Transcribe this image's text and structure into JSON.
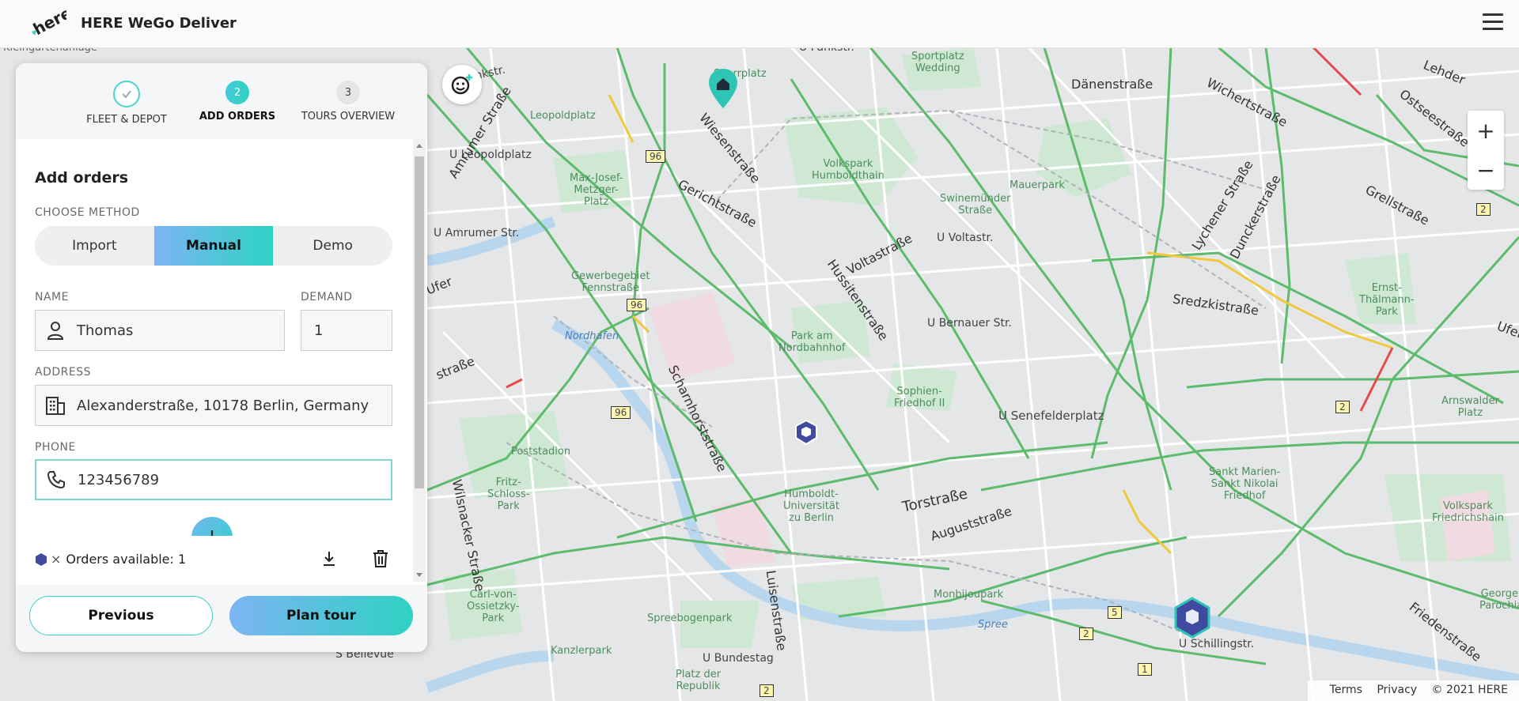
{
  "app": {
    "title": "HERE WeGo Deliver",
    "logo_text": "here"
  },
  "stepper": [
    {
      "number": "1",
      "label": "FLEET & DEPOT",
      "state": "done"
    },
    {
      "number": "2",
      "label": "ADD ORDERS",
      "state": "active"
    },
    {
      "number": "3",
      "label": "TOURS OVERVIEW",
      "state": "todo"
    }
  ],
  "form": {
    "heading": "Add orders",
    "method_caption": "CHOOSE METHOD",
    "methods": [
      "Import",
      "Manual",
      "Demo"
    ],
    "selected_method": "Manual",
    "name_caption": "NAME",
    "name_value": "Thomas",
    "demand_caption": "DEMAND",
    "demand_value": "1",
    "address_caption": "ADDRESS",
    "address_value": "Alexanderstraße, 10178 Berlin, Germany",
    "phone_caption": "PHONE",
    "phone_value": "123456789"
  },
  "orders": {
    "multiplier": "×",
    "label": "Orders available: 1"
  },
  "footer": {
    "previous_label": "Previous",
    "plan_label": "Plan tour"
  },
  "map": {
    "zoom_in": "+",
    "zoom_out": "−",
    "attribution": {
      "terms": "Terms",
      "privacy": "Privacy",
      "copyright": "© 2021 HERE"
    },
    "colors": {
      "accent": "#2ed2c3",
      "order_marker": "#3f4aa0",
      "depot_marker": "#2ec5b6",
      "rail": "#4caf50"
    },
    "labels": {
      "l1": "Kleingartenanlage",
      "l2": "Leopoldplatz",
      "l3": "U Leopoldplatz",
      "l4": "U Amrumer Str.",
      "l5": "Max-Josef-\nMetzger-\nPlatz",
      "l6": "Gewerbegebiet\nFennstraße",
      "l7": "Nordhafen",
      "l8": "Gerichtstraße",
      "l9": "Wiesenstraße",
      "l10": "Volkspark\nHumboldthain",
      "l11": "Hussitenstraße",
      "l12": "Voltastraße",
      "l13": "U Voltastr.",
      "l14": "Swinemünder\nStraße",
      "l15": "Mauerpark",
      "l16": "Dänenstraße",
      "l17": "Wichertstraße",
      "l18": "Lychener Straße",
      "l19": "Dunckerstraße",
      "l20": "Grellstraße",
      "l21": "Ostseestraße",
      "l22": "Sportplatz\nWedding",
      "l23": "Scharnhorststraße",
      "l24": "Park am\nNordbahnhof",
      "l25": "U Bernauer Str.",
      "l26": "Sophien-\nFriedhof II",
      "l27": "U Senefelderplatz",
      "l28": "Sredzkistraße",
      "l29": "Ernst-\nThälmann-\nPark",
      "l30": "Arnswalder\nPlatz",
      "l31": "Poststadion",
      "l32": "Fritz-\nSchloss-\nPark",
      "l33": "Wilsnacker Straße",
      "l34": "Humboldt-\nUniversität\nzu Berlin",
      "l35": "Luisenstraße",
      "l36": "Torstraße",
      "l37": "Auguststraße",
      "l38": "Sankt Marien-\nSankt Nikolai\nFriedhof",
      "l39": "Volkspark\nFriedrichshain",
      "l40": "Carl-von-\nOssietzky-\nPark",
      "l41": "Spreebogenpark",
      "l42": "Kanzlerpark",
      "l43": "Monbijoupark",
      "l44": "Spree",
      "l45": "U Bundestag",
      "l46": "Platz der\nRepublik",
      "l47": "U Schillingstr.",
      "l48": "Friedenstraße",
      "l49": "S Bellevue",
      "l50": "Georgen\nParochial",
      "l51": "Lehder",
      "l52": "Ufer",
      "l53": "Ufer",
      "l54": "straße",
      "l55": "U Pankstr.",
      "l56": "Pankstr.",
      "l57": "Sparrplatz",
      "l58": "Amrumer Straße"
    },
    "road_numbers": [
      "96",
      "96",
      "96",
      "2",
      "2",
      "2",
      "5",
      "1",
      "2"
    ]
  }
}
